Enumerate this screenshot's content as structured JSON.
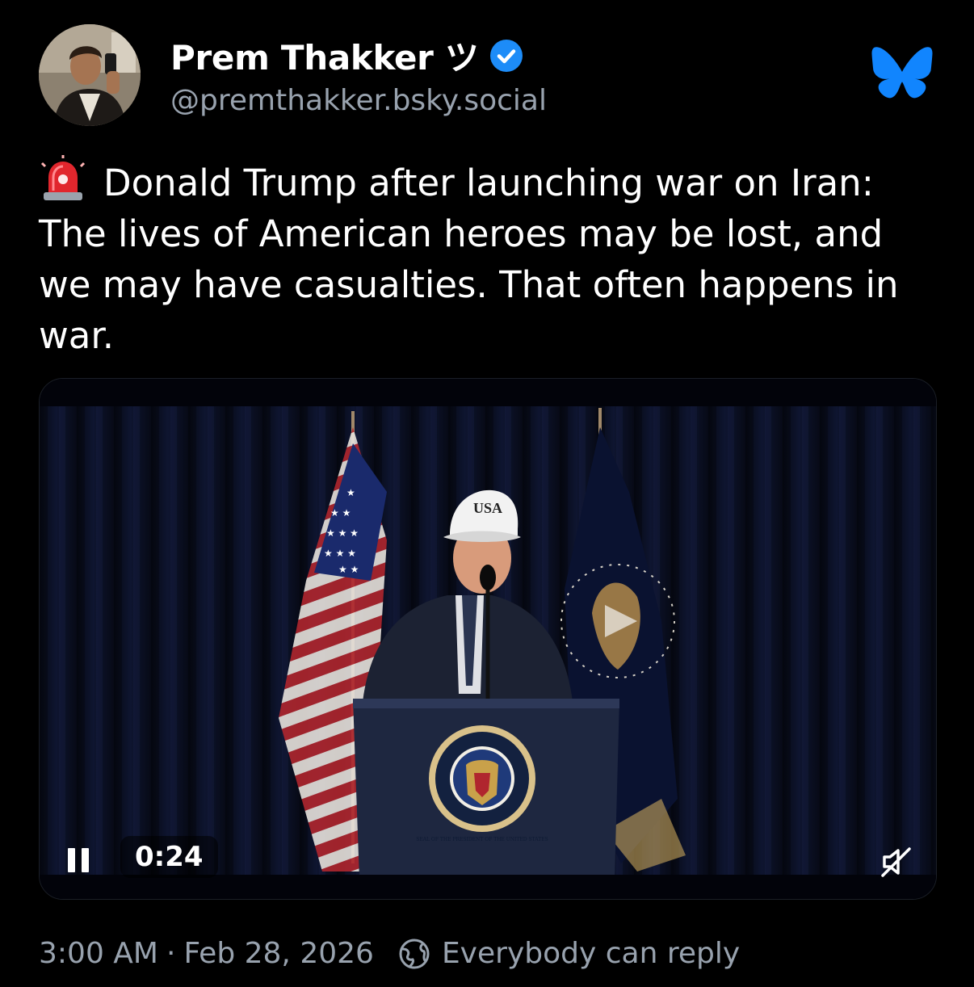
{
  "author": {
    "display_name": "Prem Thakker ツ",
    "handle": "@premthakker.bsky.social",
    "avatar_icon": "profile-photo",
    "verified_icon": "verified-badge-icon"
  },
  "app_icon": "bluesky-butterfly-icon",
  "post": {
    "emoji_icon": "police-siren-icon",
    "text": "Donald Trump after launching war on Iran: The lives of American heroes may be lost, and we may have casualties. That often happens in war."
  },
  "video": {
    "time": "0:24",
    "cap_text": "USA",
    "seal_text": "SEAL OF THE PRESIDENT OF THE UNITED STATES",
    "controls": {
      "pause_icon": "pause-icon",
      "mute_icon": "muted-speaker-icon"
    }
  },
  "footer": {
    "time": "3:00 AM",
    "separator": "·",
    "date": "Feb 28, 2026",
    "reply_setting": "Everybody can reply",
    "reply_icon": "globe-icon"
  },
  "colors": {
    "background": "#000000",
    "text": "#ffffff",
    "secondary_text": "#98a2ae",
    "bluesky_blue": "#1185fe",
    "verified_blue": "#1d8cf8"
  }
}
